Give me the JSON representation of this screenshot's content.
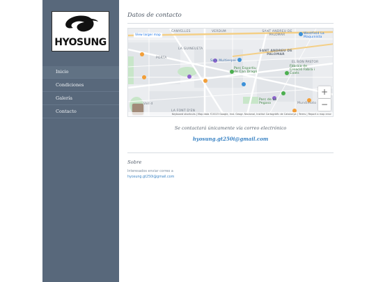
{
  "brand": {
    "logo_text": "HYOSUNG"
  },
  "nav": {
    "items": [
      {
        "label": "Inicio",
        "active": true
      },
      {
        "label": "Condiciones",
        "active": false
      },
      {
        "label": "Galería",
        "active": false
      },
      {
        "label": "Contacto",
        "active": false
      }
    ]
  },
  "main": {
    "title": "Datos de contacto",
    "map": {
      "view_larger": "View larger map",
      "labels": [
        "CANYELLES",
        "VERDUM",
        "SANT ANDREU DE PALOMAR",
        "Westfield La Maquinista",
        "LA GUINEUETA",
        "PORTA",
        "Sam Multiespai",
        "SANT ANDREU DE PALOMAR",
        "EL BON PASTOR",
        "Parc Esportiu de Can Dragó",
        "Fàbrica de Creació Fabra i Coats",
        "Parc de La Pegaso",
        "Mundimoto",
        "LA FONT D'EN",
        "Vall d"
      ],
      "attribution": "Keyboard shortcuts | Map data ©2023 Google, Inst. Geogr. Nacional, Institut Cartogràfic de Catalunya | Terms | Report a map error",
      "zoom_in": "+",
      "zoom_out": "−"
    },
    "note": "Se contactará únicamente vía correo electrónico",
    "email": "hyosung.gt250i@gmail.com",
    "about": {
      "title": "Sobre",
      "text": "Interesados enviar correo a",
      "email": "hyosung.gt250i@gmail.com"
    }
  },
  "colors": {
    "sidebar": "#58687b",
    "accent": "#3a83c4"
  }
}
